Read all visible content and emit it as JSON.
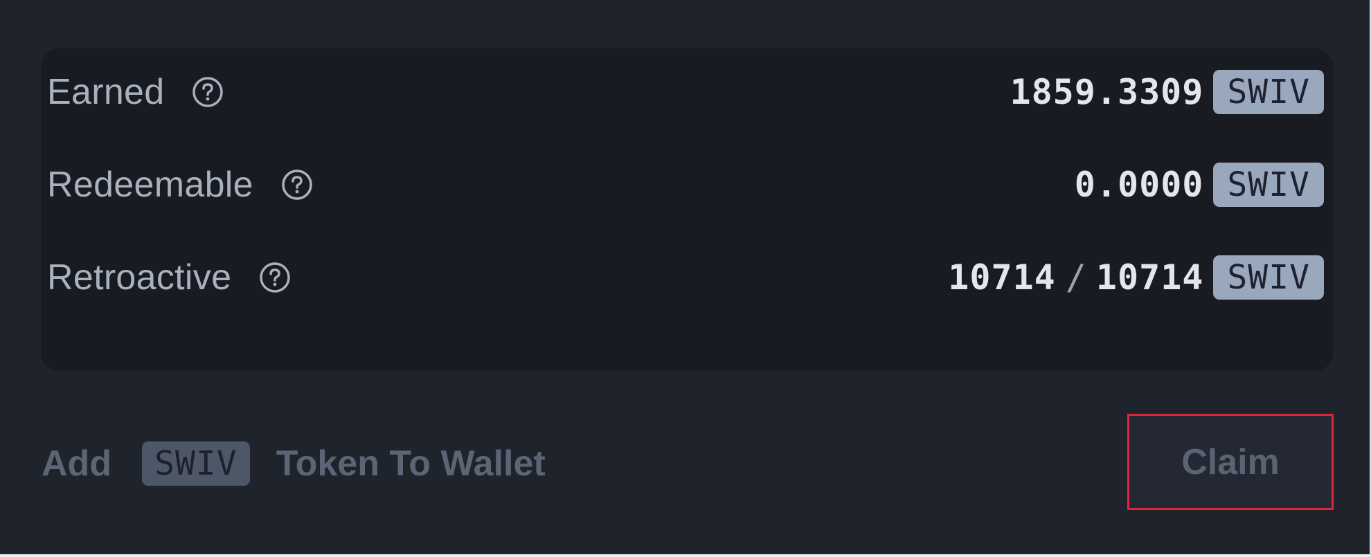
{
  "rewards": [
    {
      "label": "Earned",
      "value": "1859.3309",
      "token": "SWIV",
      "icon": "help-icon"
    },
    {
      "label": "Redeemable",
      "value": "0.0000",
      "token": "SWIV",
      "icon": "help-icon"
    },
    {
      "label": "Retroactive",
      "value_current": "10714",
      "value_separator": "/",
      "value_total": "10714",
      "token": "SWIV",
      "icon": "help-icon"
    }
  ],
  "footer": {
    "add_label": "Add",
    "token": "SWIV",
    "wallet_label": "Token To Wallet",
    "claim_label": "Claim"
  },
  "colors": {
    "background": "#1f232c",
    "panel": "#181b22",
    "badge": "#9aa8be",
    "highlight_border": "#e0243e"
  }
}
